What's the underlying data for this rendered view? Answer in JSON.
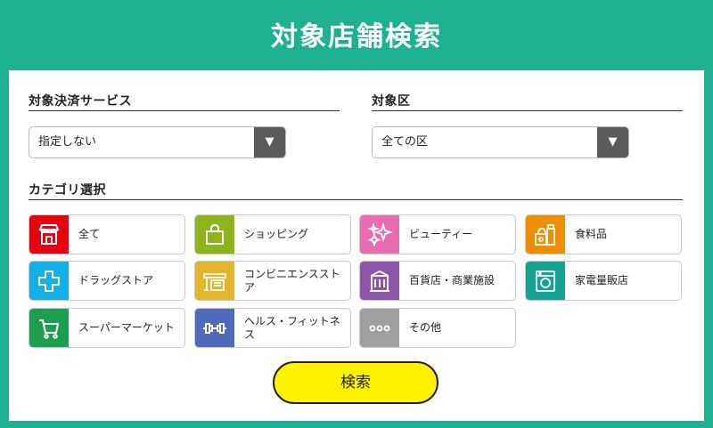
{
  "page": {
    "title": "対象店舗検索"
  },
  "payment": {
    "label": "対象決済サービス",
    "selected": "指定しない"
  },
  "area": {
    "label": "対象区",
    "selected": "全ての区"
  },
  "category": {
    "label": "カテゴリ選択",
    "items": [
      {
        "label": "全て",
        "icon": "store-icon",
        "color": "#e60012"
      },
      {
        "label": "ショッピング",
        "icon": "shopping-bag-icon",
        "color": "#8fb31d"
      },
      {
        "label": "ビューティー",
        "icon": "sparkle-icon",
        "color": "#e86cb0"
      },
      {
        "label": "食料品",
        "icon": "grocery-icon",
        "color": "#f08c00"
      },
      {
        "label": "ドラッグストア",
        "icon": "medical-cross-icon",
        "color": "#12b0e6"
      },
      {
        "label": "コンビニエンスストア",
        "icon": "convenience-store-icon",
        "color": "#e3b52a"
      },
      {
        "label": "百貨店・商業施設",
        "icon": "department-store-icon",
        "color": "#8e56a8"
      },
      {
        "label": "家電量販店",
        "icon": "washing-machine-icon",
        "color": "#16a394"
      },
      {
        "label": "スーパーマーケット",
        "icon": "shopping-cart-icon",
        "color": "#1c9e4e"
      },
      {
        "label": "ヘルス・フィットネス",
        "icon": "dumbbell-icon",
        "color": "#4e6ab8"
      },
      {
        "label": "その他",
        "icon": "more-dots-icon",
        "color": "#a0a0a0"
      }
    ]
  },
  "search": {
    "label": "検索"
  },
  "colors": {
    "background": "#1db091",
    "button": "#fff200",
    "dropdown_arrow_bg": "#5a5a5a"
  }
}
